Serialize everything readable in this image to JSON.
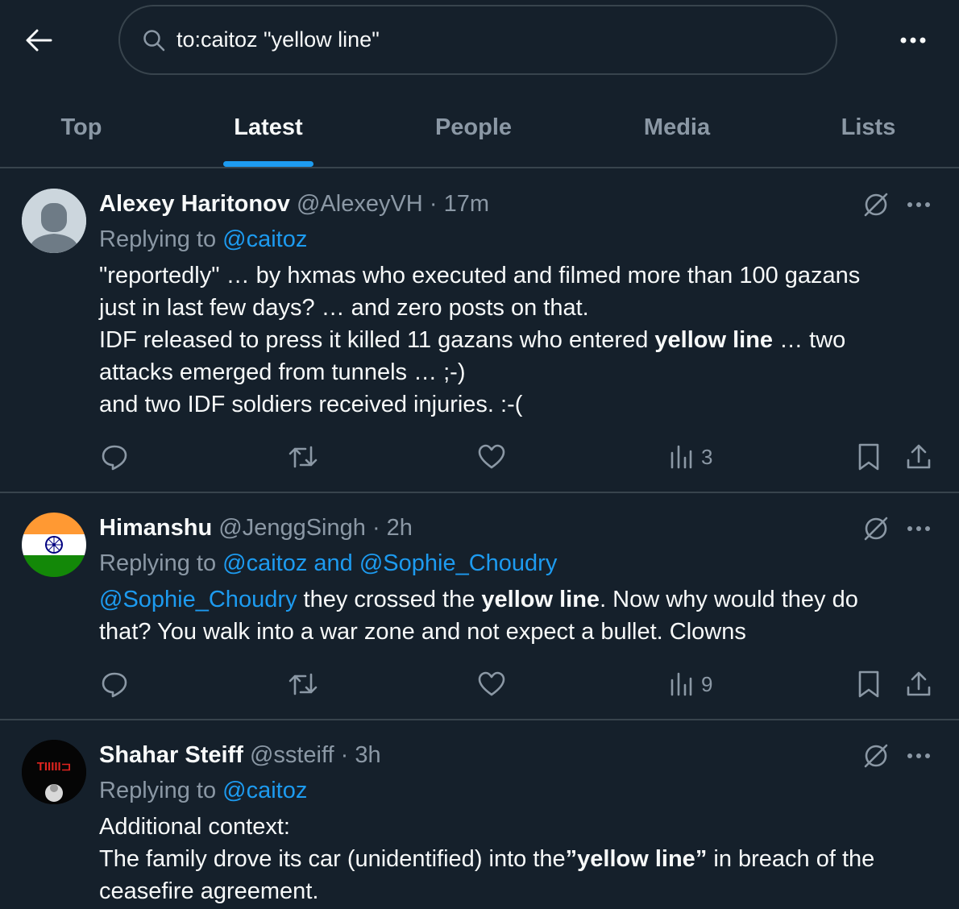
{
  "header": {
    "search_value": "to:caitoz \"yellow line\""
  },
  "tabs": [
    {
      "label": "Top"
    },
    {
      "label": "Latest"
    },
    {
      "label": "People"
    },
    {
      "label": "Media"
    },
    {
      "label": "Lists"
    }
  ],
  "active_tab": "Latest",
  "colors": {
    "background": "#15202b",
    "accent": "#1d9bf0",
    "muted": "#8b98a5",
    "divider": "#38444d"
  },
  "tweets": [
    {
      "name": "Alexey Haritonov",
      "handle": "@AlexeyVH",
      "sep": "·",
      "time": "17m",
      "replying_prefix": "Replying to",
      "replying_to": "@caitoz",
      "body": {
        "l1": "\"reportedly\" … by hxmas who executed and filmed more than 100 gazans",
        "l2": "just in last few days? … and zero posts on that.",
        "l3a": "IDF released to press it killed 11 gazans who entered ",
        "l3b": "yellow line",
        "l3c": " … two",
        "l4": "attacks emerged from tunnels … ;-)",
        "l5": "and two IDF soldiers received injuries. :-("
      },
      "views": "3",
      "avatar": "default-avatar"
    },
    {
      "name": "Himanshu",
      "handle": "@JenggSingh",
      "sep": "·",
      "time": "2h",
      "replying_prefix": "Replying to",
      "replying_to": "@caitoz and @Sophie_Choudry",
      "body": {
        "mention": "@Sophie_Choudry",
        "t1": " they crossed the ",
        "bold": "yellow line",
        "t2": ". Now why would they do",
        "l2": "that? You walk into a war zone and not expect a bullet. Clowns"
      },
      "views": "9",
      "avatar": "india-flag-avatar"
    },
    {
      "name": "Shahar Steiff",
      "handle": "@ssteiff",
      "sep": "·",
      "time": "3h",
      "replying_prefix": "Replying to",
      "replying_to": "@caitoz",
      "body": {
        "l1": "Additional context:",
        "l2a": "The family drove its car (unidentified) into the",
        "l2b": "”yellow line”",
        "l2c": " in breach of the",
        "l3": "ceasefire agreement."
      },
      "avatar": "profile-photo-avatar",
      "avatar_text": "TIIIII⊐"
    }
  ]
}
